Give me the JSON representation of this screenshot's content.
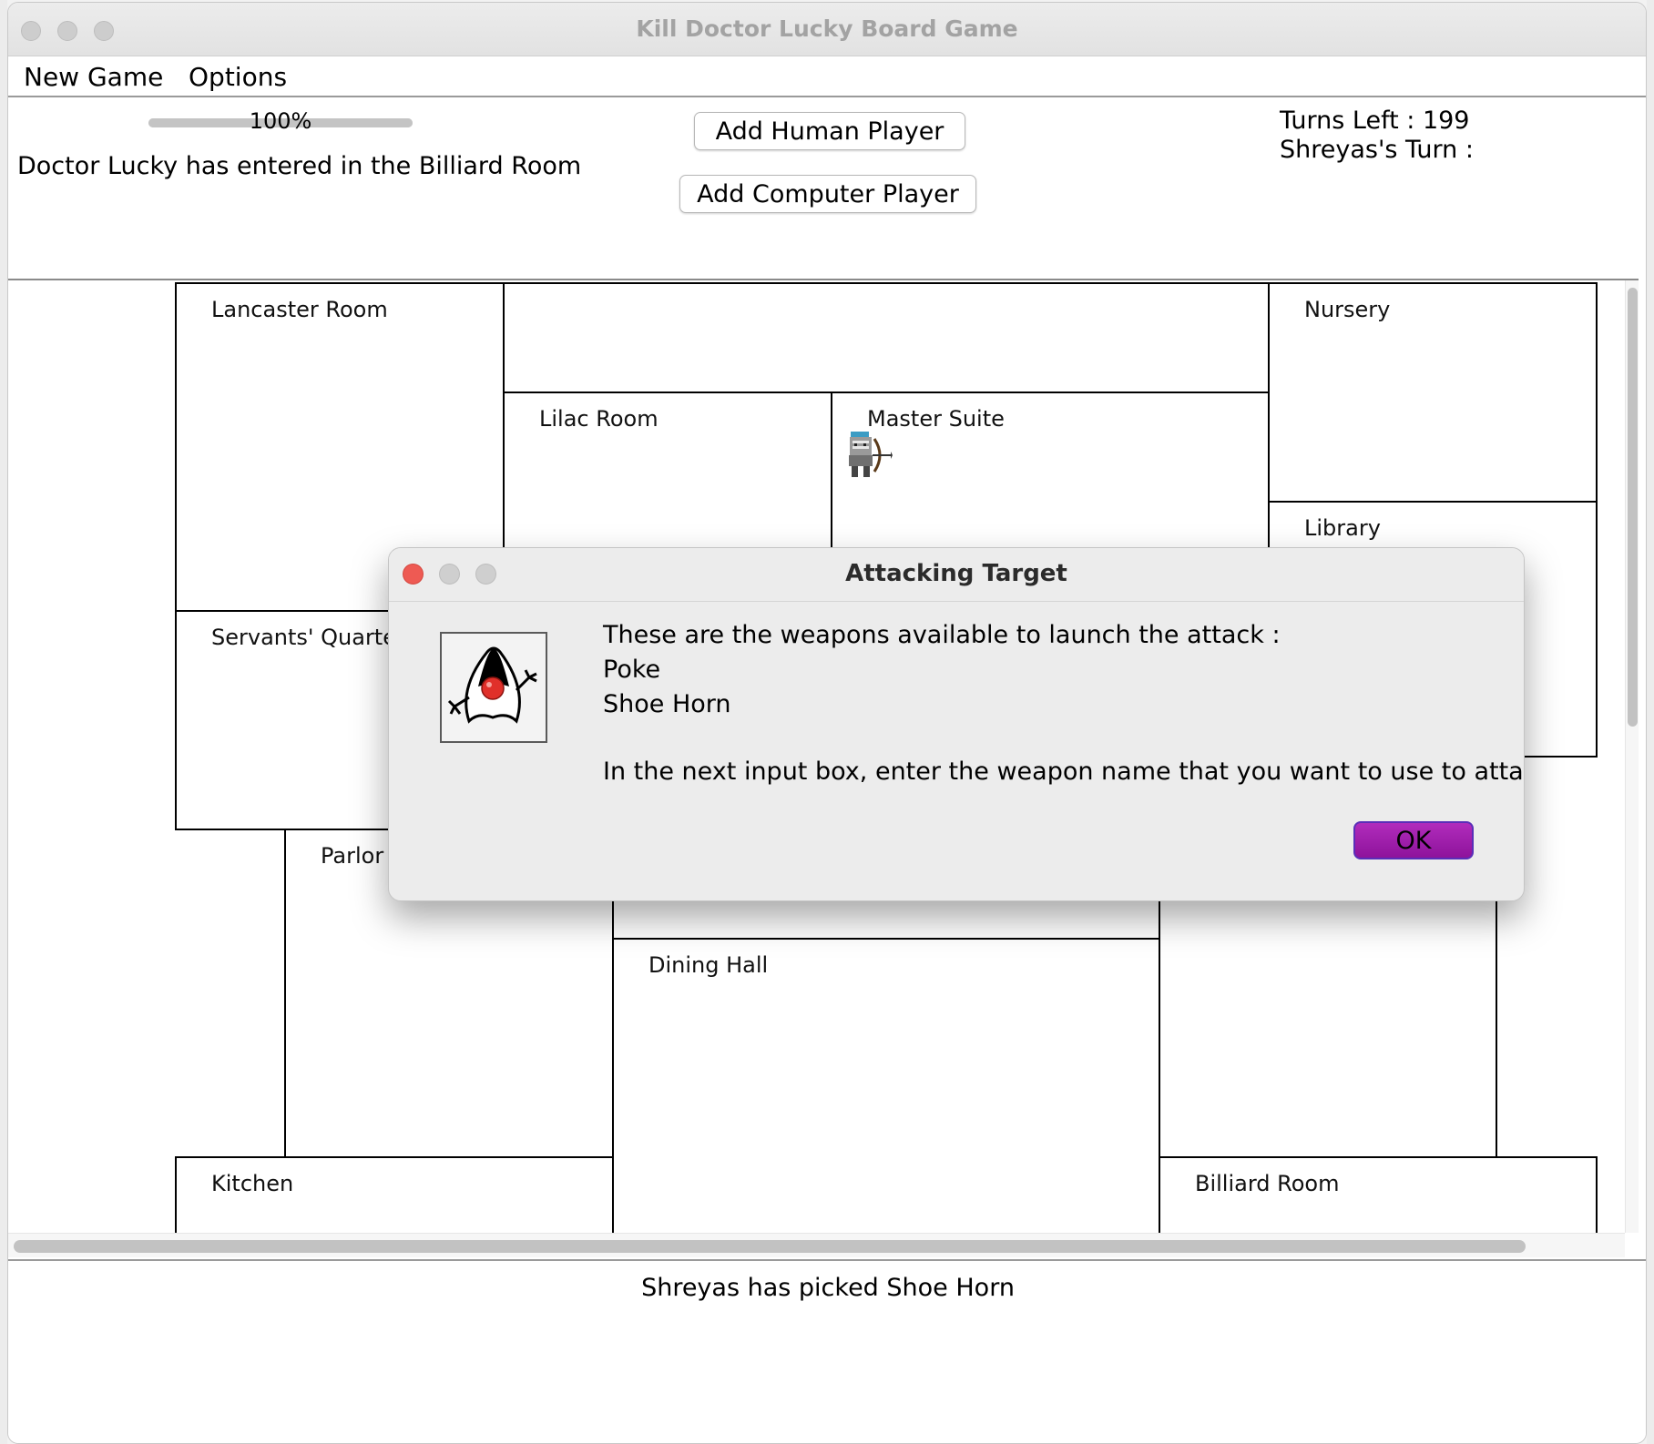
{
  "window": {
    "title": "Kill Doctor Lucky Board Game"
  },
  "menu": {
    "items": [
      "New Game",
      "Options"
    ]
  },
  "top": {
    "progress_value": 1.0,
    "progress_label": "100%",
    "status_message": "Doctor Lucky has entered in the Billiard Room",
    "add_human_label": "Add Human Player",
    "add_computer_label": "Add Computer Player",
    "turns_left": "Turns Left : 199",
    "current_turn": "Shreyas's Turn :"
  },
  "board": {
    "rooms": [
      "Lancaster Room",
      "Lilac Room",
      "Master Suite",
      "Nursery",
      "Library",
      "Servants' Quarters",
      "Parlor",
      "Dining Hall",
      "Kitchen",
      "Billiard Room"
    ]
  },
  "bottom": {
    "message": "Shreyas has picked Shoe Horn"
  },
  "dialog": {
    "title": "Attacking Target",
    "lines": [
      "These are the weapons available to launch the attack :",
      "Poke",
      "Shoe Horn",
      "In the next input box, enter the weapon name that you want to use to attack."
    ],
    "ok_label": "OK",
    "accent_color": "#9a1fa7"
  },
  "icons": {
    "player_token": "archer-sprite-icon",
    "dialog_icon": "java-duke-icon"
  }
}
